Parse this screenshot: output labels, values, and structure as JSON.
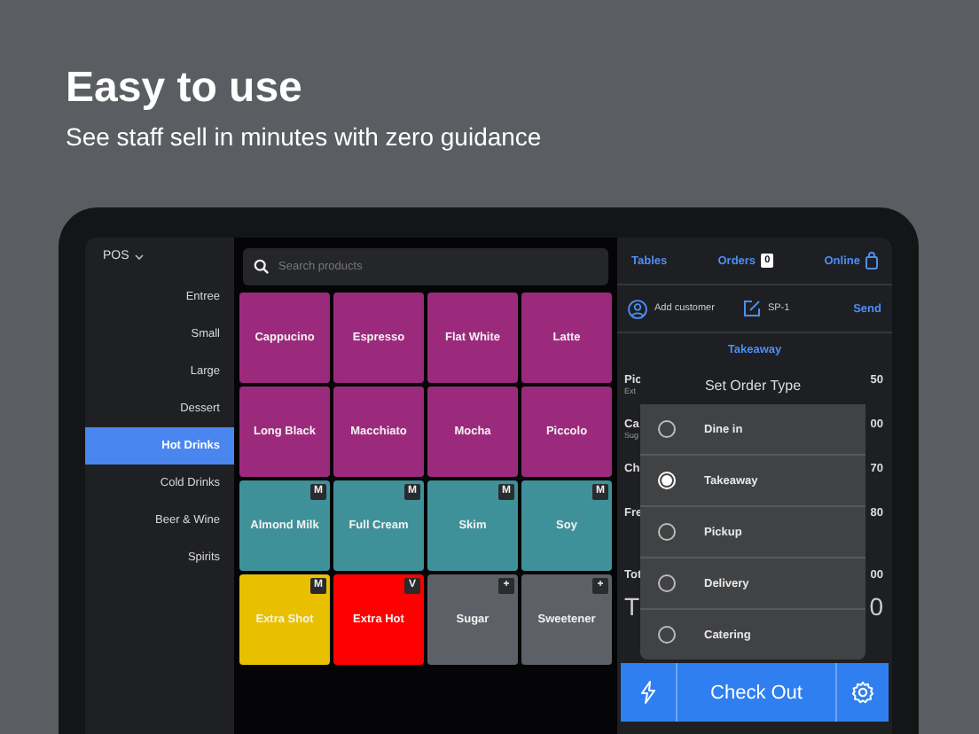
{
  "headline": "Easy to use",
  "subheadline": "See staff sell in minutes with zero guidance",
  "sidebar": {
    "menu": "POS",
    "items": [
      {
        "label": "Entree",
        "selected": false
      },
      {
        "label": "Small",
        "selected": false
      },
      {
        "label": "Large",
        "selected": false
      },
      {
        "label": "Dessert",
        "selected": false
      },
      {
        "label": "Hot Drinks",
        "selected": true
      },
      {
        "label": "Cold Drinks",
        "selected": false
      },
      {
        "label": "Beer & Wine",
        "selected": false
      },
      {
        "label": "Spirits",
        "selected": false
      }
    ]
  },
  "search": {
    "placeholder": "Search products"
  },
  "products": [
    {
      "name": "Cappucino",
      "color": "#9c2a7c"
    },
    {
      "name": "Espresso",
      "color": "#9c2a7c"
    },
    {
      "name": "Flat White",
      "color": "#9c2a7c"
    },
    {
      "name": "Latte",
      "color": "#9c2a7c"
    },
    {
      "name": "Long Black",
      "color": "#9c2a7c"
    },
    {
      "name": "Macchiato",
      "color": "#9c2a7c"
    },
    {
      "name": "Mocha",
      "color": "#9c2a7c"
    },
    {
      "name": "Piccolo",
      "color": "#9c2a7c"
    },
    {
      "name": "Almond Milk",
      "color": "#3f9199",
      "badge": "M"
    },
    {
      "name": "Full Cream",
      "color": "#3f9199",
      "badge": "M"
    },
    {
      "name": "Skim",
      "color": "#3f9199",
      "badge": "M"
    },
    {
      "name": "Soy",
      "color": "#3f9199",
      "badge": "M"
    },
    {
      "name": "Extra Shot",
      "color": "#e8c000",
      "badge": "M"
    },
    {
      "name": "Extra Hot",
      "color": "#fe0000",
      "badge": "V"
    },
    {
      "name": "Sugar",
      "color": "#5d6167",
      "badge": "+"
    },
    {
      "name": "Sweetener",
      "color": "#5d6167",
      "badge": "+"
    }
  ],
  "order_panel": {
    "tabs": [
      {
        "label": "Tables"
      },
      {
        "label": "Orders",
        "count": "0"
      },
      {
        "label": "Online"
      }
    ],
    "customer": "Add customer",
    "order_ref": "SP-1",
    "send": "Send",
    "order_type": "Takeaway",
    "lines": [
      {
        "name": "Pic",
        "detail": "Ext",
        "price": "50"
      },
      {
        "name": "Ca",
        "detail": "Sug",
        "price": "00"
      },
      {
        "name": "Ch",
        "price": "70"
      },
      {
        "name": "Fre",
        "price": "80"
      }
    ],
    "subtotal": {
      "label": "Tot",
      "value": "00"
    },
    "total": {
      "label": "T",
      "value": "0"
    },
    "checkout": "Check Out"
  },
  "dialog": {
    "title": "Set Order Type",
    "options": [
      {
        "label": "Dine in",
        "selected": false
      },
      {
        "label": "Takeaway",
        "selected": true
      },
      {
        "label": "Pickup",
        "selected": false
      },
      {
        "label": "Delivery",
        "selected": false
      },
      {
        "label": "Catering",
        "selected": false
      }
    ]
  }
}
